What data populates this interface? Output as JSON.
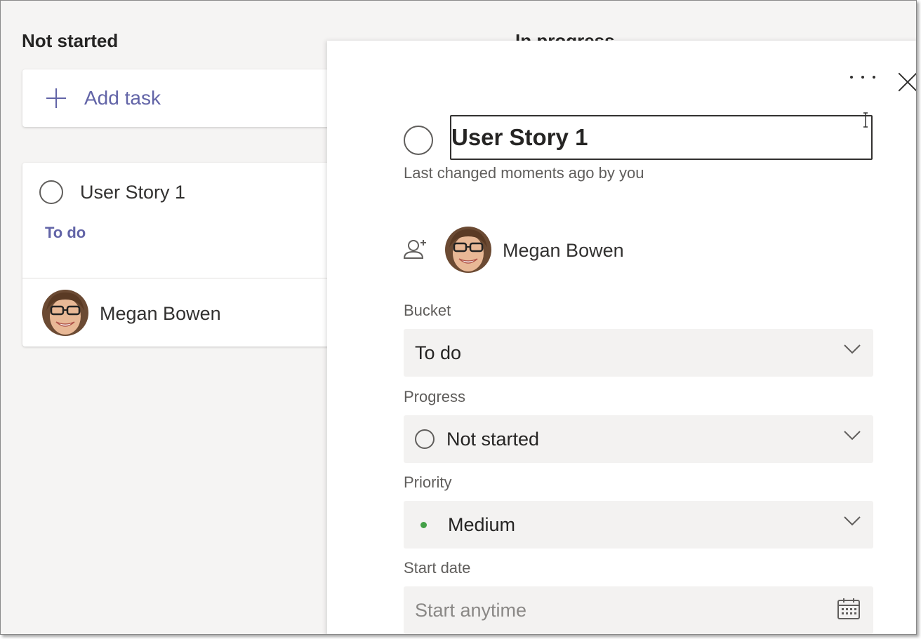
{
  "colors": {
    "accent": "#6264a7",
    "priority_medium": "#43a047",
    "board_bg": "#f5f4f3"
  },
  "board": {
    "columns": [
      {
        "title": "Not started"
      },
      {
        "title": "In progress"
      }
    ],
    "add_task_label": "Add task",
    "card": {
      "title": "User Story 1",
      "bucket": "To do",
      "assignee": "Megan Bowen"
    }
  },
  "panel": {
    "task_title": "User Story 1",
    "last_changed": "Last changed moments ago by you",
    "assignee": "Megan Bowen",
    "bucket": {
      "label": "Bucket",
      "value": "To do"
    },
    "progress": {
      "label": "Progress",
      "value": "Not started"
    },
    "priority": {
      "label": "Priority",
      "value": "Medium"
    },
    "start_date": {
      "label": "Start date",
      "placeholder": "Start anytime"
    }
  }
}
